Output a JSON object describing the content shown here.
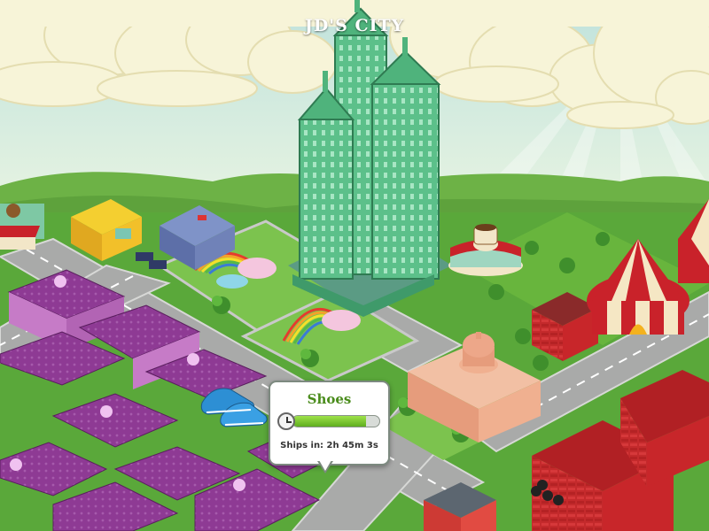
{
  "city_name": "JD'S CITY",
  "tooltip": {
    "title": "Shoes",
    "progress": 0.85,
    "ships_in_label": "Ships in: 2h 45m 3s",
    "icon": "clock-icon"
  },
  "colors": {
    "sky": "#cfe9e6",
    "grass": "#5aa83a",
    "road": "#a9aaa9",
    "skyscraper": "#4fb37c",
    "purple_buildings": "#8a2e8e",
    "red_buildings": "#c8262a",
    "tent_red": "#c9222a",
    "tent_cream": "#f5e7c4",
    "progress_fill": "#6cc02a",
    "tooltip_title": "#4a8c1c"
  }
}
